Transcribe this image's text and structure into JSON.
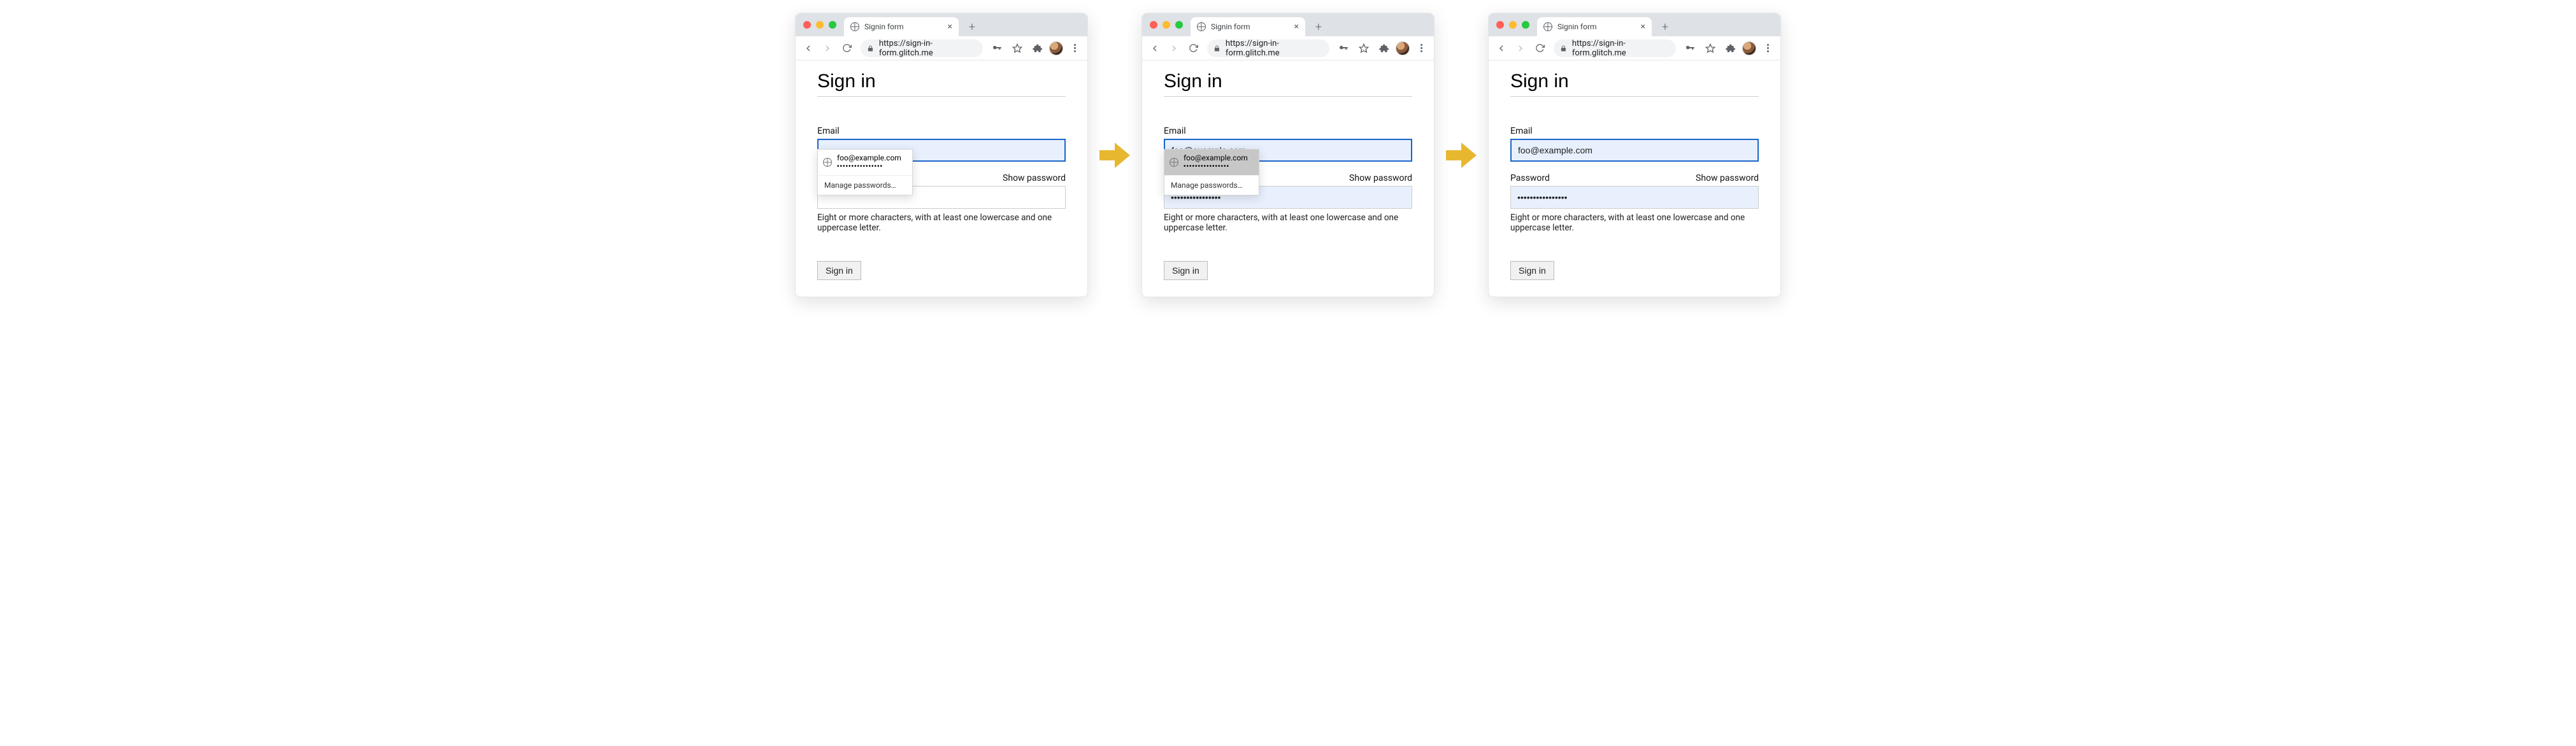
{
  "browser": {
    "tab_title": "Signin form",
    "new_tab_glyph": "+",
    "close_tab_glyph": "×",
    "url": "https://sign-in-form.glitch.me"
  },
  "page": {
    "heading": "Sign in",
    "email_label": "Email",
    "password_label": "Password",
    "show_password": "Show password",
    "hint": "Eight or more characters, with at least one lowercase and one uppercase letter.",
    "signin_button": "Sign in"
  },
  "autofill": {
    "email": "foo@example.com",
    "password_mask": "••••••••••••••••",
    "manage": "Manage passwords…"
  },
  "states": [
    {
      "email_value": "",
      "email_focused": true,
      "password_value": "",
      "password_autofilled": false,
      "dropdown_visible": true,
      "dropdown_item_hover": false
    },
    {
      "email_value": "foo@example.com",
      "email_focused": true,
      "password_value": "••••••••••••••••",
      "password_autofilled": true,
      "dropdown_visible": true,
      "dropdown_item_hover": true
    },
    {
      "email_value": "foo@example.com",
      "email_focused": true,
      "password_value": "••••••••••••••••",
      "password_autofilled": true,
      "dropdown_visible": false,
      "dropdown_item_hover": false
    }
  ]
}
